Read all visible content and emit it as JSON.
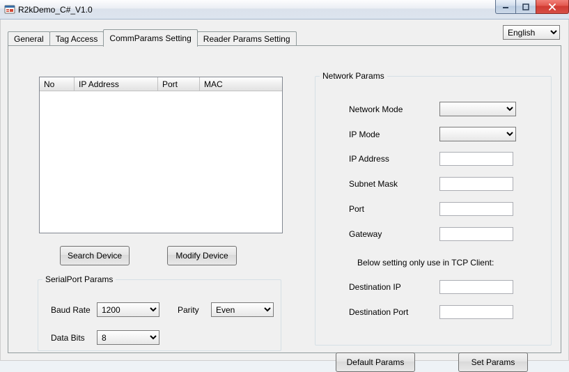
{
  "window": {
    "title": "R2kDemo_C#_V1.0"
  },
  "language": {
    "value": "English",
    "options": [
      "English"
    ]
  },
  "tabs": [
    {
      "label": "General"
    },
    {
      "label": "Tag Access"
    },
    {
      "label": "CommParams Setting"
    },
    {
      "label": "Reader Params Setting"
    }
  ],
  "table": {
    "cols": {
      "no": "No",
      "ip": "IP Address",
      "port": "Port",
      "mac": "MAC"
    }
  },
  "buttons": {
    "search": "Search Device",
    "modify": "Modify Device",
    "default_params": "Default Params",
    "set_params": "Set Params"
  },
  "serial": {
    "legend": "SerialPort Params",
    "baud_label": "Baud Rate",
    "baud_value": "1200",
    "parity_label": "Parity",
    "parity_value": "Even",
    "databits_label": "Data Bits",
    "databits_value": "8"
  },
  "network": {
    "legend": "Network Params",
    "mode_label": "Network Mode",
    "mode_value": "",
    "ipmode_label": "IP Mode",
    "ipmode_value": "",
    "ip_label": "IP Address",
    "ip_value": "",
    "subnet_label": "Subnet Mask",
    "subnet_value": "",
    "port_label": "Port",
    "port_value": "",
    "gateway_label": "Gateway",
    "gateway_value": "",
    "tcp_note": "Below setting only use in TCP Client:",
    "destip_label": "Destination IP",
    "destip_value": "",
    "destport_label": "Destination Port",
    "destport_value": ""
  }
}
